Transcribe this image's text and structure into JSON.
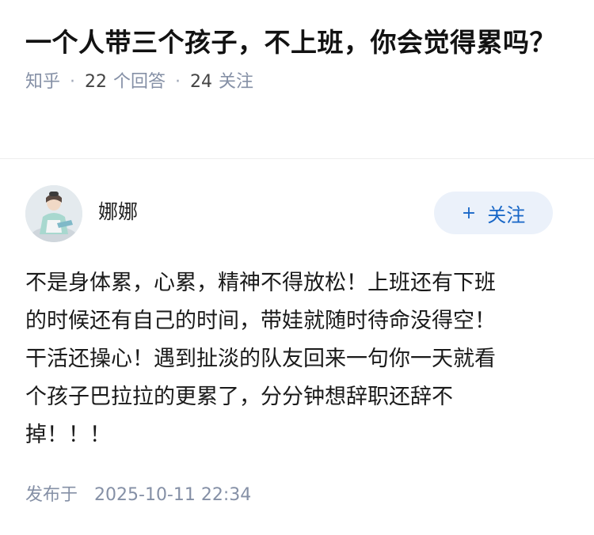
{
  "question": {
    "title": "一个人带三个孩子，不上班，你会觉得累吗？",
    "source": "知乎",
    "answer_count": "22",
    "answer_unit": "个回答",
    "follower_count": "24",
    "follower_unit": "关注"
  },
  "answer": {
    "author": "娜娜",
    "follow_label": "关注",
    "follow_icon": "plus-icon",
    "content": "不是身体累，心累，精神不得放松！上班还有下班\n的时候还有自己的时间，带娃就随时待命没得空！\n干活还操心！遇到扯淡的队友回来一句你一天就看\n个孩子巴拉拉的更累了，分分钟想辞职还辞不\n掉！！！",
    "publish_label": "发布于",
    "publish_time": "2025-10-11 22:34"
  },
  "colors": {
    "accent": "#1766c7",
    "follow_bg": "#ebf1fa",
    "meta_text": "#8590a6",
    "divider": "#eeeeee"
  }
}
